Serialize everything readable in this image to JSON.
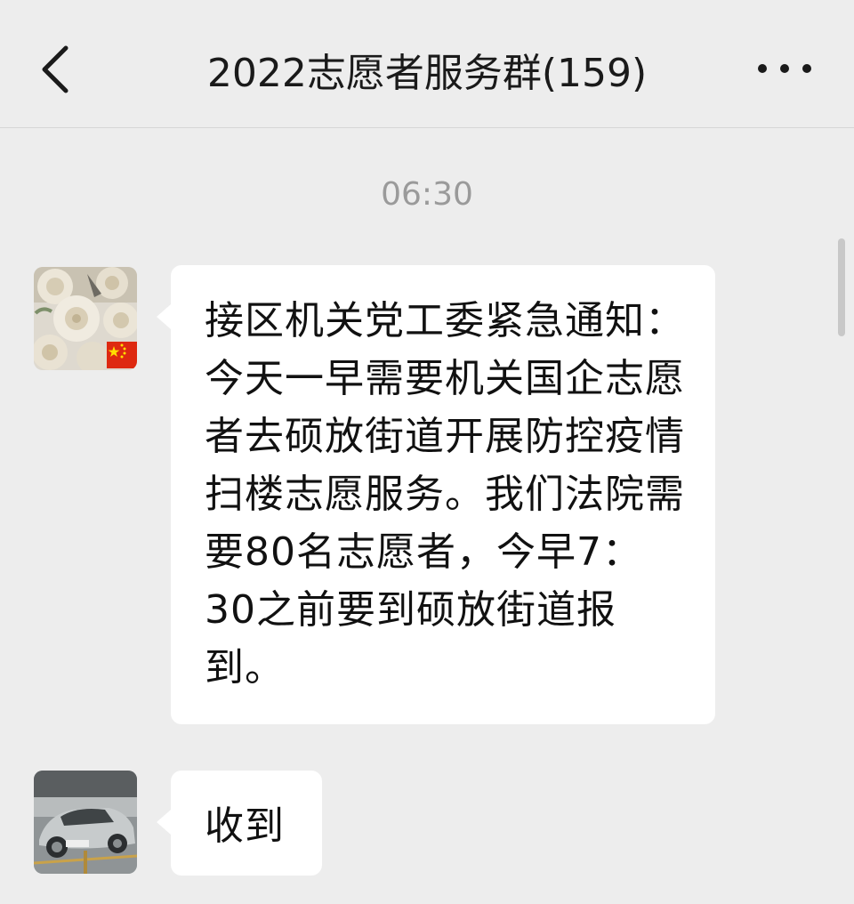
{
  "header": {
    "title": "2022志愿者服务群(159)",
    "back_icon": "chevron-left-icon",
    "more_icon": "more-dots-icon"
  },
  "chat": {
    "timestamp": "06:30",
    "messages": [
      {
        "sender_avatar": "flowers-avatar",
        "badge": "china-flag-badge",
        "text": "接区机关党工委紧急通知：今天一早需要机关国企志愿者去硕放街道开展防控疫情扫楼志愿服务。我们法院需要80名志愿者，今早7：30之前要到硕放街道报到。"
      },
      {
        "sender_avatar": "car-avatar",
        "text": "收到"
      }
    ]
  },
  "colors": {
    "background": "#ededed",
    "bubble": "#ffffff",
    "timestamp": "#9a9a9a"
  }
}
